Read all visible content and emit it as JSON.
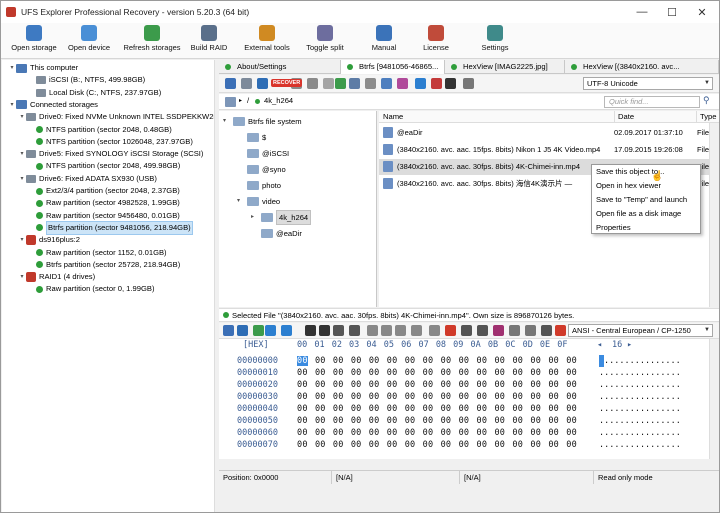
{
  "window": {
    "title": "UFS Explorer Professional Recovery - version 5.20.3 (64 bit)",
    "min": "—",
    "max": "☐",
    "close": "✕"
  },
  "ribbon": [
    {
      "label": "Open storage",
      "color": "#3e7ac2"
    },
    {
      "label": "Open device",
      "color": "#4a8fd6"
    },
    {
      "label": "Refresh storages",
      "color": "#3c9b4b"
    },
    {
      "label": "Build RAID",
      "color": "#5a6f8a"
    },
    {
      "label": "External tools",
      "color": "#d08a22"
    },
    {
      "label": "Toggle split",
      "color": "#6d6d9e"
    },
    {
      "label": "Manual",
      "color": "#3b73b9"
    },
    {
      "label": "License",
      "color": "#c04b3a"
    },
    {
      "label": "Settings",
      "color": "#3f8a8a"
    }
  ],
  "tree": [
    {
      "label": "This computer",
      "indent": 0,
      "icon": "pc",
      "exp": "▾"
    },
    {
      "label": "iSCSI (B:, NTFS, 499.98GB)",
      "indent": 2,
      "icon": "dsk",
      "exp": ""
    },
    {
      "label": "Local Disk (C:, NTFS, 237.97GB)",
      "indent": 2,
      "icon": "dsk",
      "exp": ""
    },
    {
      "label": "Connected storages",
      "indent": 0,
      "icon": "pc",
      "exp": "▾"
    },
    {
      "label": "Drive0: Fixed NVMe Unknown INTEL SSDPEKKW25",
      "indent": 1,
      "icon": "dsk",
      "exp": "▾"
    },
    {
      "label": "NTFS partition (sector 2048, 0.48GB)",
      "indent": 2,
      "icon": "dot",
      "exp": ""
    },
    {
      "label": "NTFS partition (sector 1026048, 237.97GB)",
      "indent": 2,
      "icon": "dot",
      "exp": ""
    },
    {
      "label": "Drive5: Fixed SYNOLOGY iSCSI Storage (SCSI)",
      "indent": 1,
      "icon": "dsk",
      "exp": "▾"
    },
    {
      "label": "NTFS partition (sector 2048, 499.98GB)",
      "indent": 2,
      "icon": "dot",
      "exp": ""
    },
    {
      "label": "Drive6: Fixed ADATA SX930 (USB)",
      "indent": 1,
      "icon": "dsk",
      "exp": "▾"
    },
    {
      "label": "Ext2/3/4 partition (sector 2048, 2.37GB)",
      "indent": 2,
      "icon": "dot",
      "exp": ""
    },
    {
      "label": "Raw partition (sector 4982528, 1.99GB)",
      "indent": 2,
      "icon": "dot",
      "exp": ""
    },
    {
      "label": "Raw partition (sector 9456480, 0.01GB)",
      "indent": 2,
      "icon": "dot",
      "exp": ""
    },
    {
      "label": "Btrfs partition (sector 9481056, 218.94GB)",
      "indent": 2,
      "icon": "dot",
      "exp": "",
      "selected": true
    },
    {
      "label": "ds916plus:2",
      "indent": 1,
      "icon": "nas",
      "exp": "▾"
    },
    {
      "label": "Raw partition (sector 1152, 0.01GB)",
      "indent": 2,
      "icon": "dot",
      "exp": ""
    },
    {
      "label": "Btrfs partition (sector 25728, 218.94GB)",
      "indent": 2,
      "icon": "dot",
      "exp": ""
    },
    {
      "label": "RAID1 (4 drives)",
      "indent": 1,
      "icon": "nas",
      "exp": "▾"
    },
    {
      "label": "Raw partition (sector 0, 1.99GB)",
      "indent": 2,
      "icon": "dot",
      "exp": ""
    }
  ],
  "tabs": [
    {
      "label": "About/Settings",
      "active": false
    },
    {
      "label": "Btrfs [9481056-46865...",
      "active": true
    },
    {
      "label": "HexView [IMAG2225.jpg]",
      "active": false
    },
    {
      "label": "HexView [(3840x2160. avc...",
      "active": false
    }
  ],
  "toolbar": {
    "recover_label": "RECOVER",
    "encoding": "UTF-8 Unicode"
  },
  "path": {
    "separator": "/",
    "dir": "4k_h264",
    "find_placeholder": "Quick find..."
  },
  "fstree": [
    {
      "label": "Btrfs file system",
      "indent": 0,
      "exp": "▾"
    },
    {
      "label": "$",
      "indent": 1,
      "exp": ""
    },
    {
      "label": "@iSCSI",
      "indent": 1,
      "exp": ""
    },
    {
      "label": "@syno",
      "indent": 1,
      "exp": ""
    },
    {
      "label": "photo",
      "indent": 1,
      "exp": ""
    },
    {
      "label": "video",
      "indent": 1,
      "exp": "▾"
    },
    {
      "label": "4k_h264",
      "indent": 2,
      "exp": "▸",
      "selected": true
    },
    {
      "label": "@eaDir",
      "indent": 2,
      "exp": ""
    }
  ],
  "filelist": {
    "headers": {
      "name": "Name",
      "date": "Date",
      "type": "Type"
    },
    "rows": [
      {
        "name": "@eaDir",
        "date": "02.09.2017 01:37:10",
        "type": "File f"
      },
      {
        "name": "(3840x2160. avc. aac. 15fps. 8bits) Nikon 1 J5  4K Video.mp4",
        "date": "17.09.2015 19:26:08",
        "type": "File"
      },
      {
        "name": "(3840x2160. avc. aac. 30fps. 8bits) 4K-Chimei-inn.mp4",
        "date": "",
        "type": "File",
        "selected": true
      },
      {
        "name": "(3840x2160. avc. aac. 30fps. 8bits) 海信4K演示片 —",
        "date": "",
        "type": "File"
      }
    ]
  },
  "context_menu": [
    "Save this object to...",
    "Open in hex viewer",
    "Save to \"Temp\" and launch",
    "Open file as a disk image",
    "Properties"
  ],
  "status": "Selected File \"(3840x2160. avc. aac. 30fps. 8bits) 4K-Chimei-inn.mp4\". Own size is 896870126 bytes.",
  "hex": {
    "encoding": "ANSI - Central European / CP-1250",
    "columns_label": "16",
    "header_label": "[HEX]",
    "columns": "00 01 02 03 04 05 06 07 08 09 0A 0B 0C 0D 0E 0F",
    "offsets": [
      "00000000",
      "00000010",
      "00000020",
      "00000030",
      "00000040",
      "00000050",
      "00000060",
      "00000070"
    ],
    "row_bytes": "00 00 00 00 00 00 00 00 00 00 00 00 00 00 00 00",
    "row_bytes_tail": "00 00 00 00 00 00 00 00 00 00 00 00 00 00 00",
    "first_byte": "00",
    "ascii": "................",
    "ascii_tail": "..............."
  },
  "bottom": {
    "position": "Position: 0x0000",
    "na1": "[N/A]",
    "na2": "[N/A]",
    "mode": "Read only mode"
  }
}
